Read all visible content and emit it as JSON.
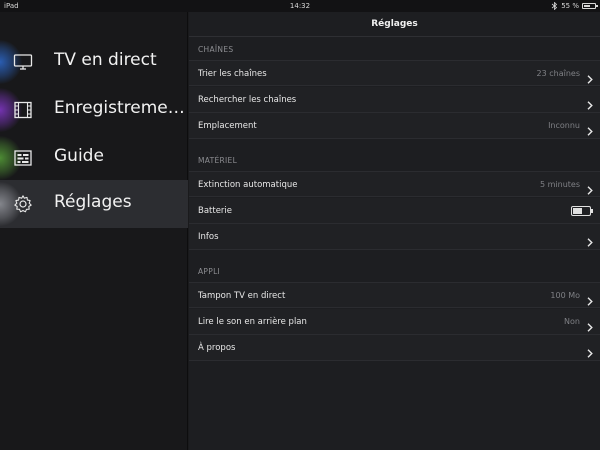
{
  "status_bar": {
    "device": "iPad",
    "time": "14:32",
    "battery_text": "55 %",
    "battery_level": 0.55
  },
  "sidebar": {
    "items": [
      {
        "label": "TV en direct",
        "icon": "tv-icon",
        "glow": "#2f6fd8",
        "active": false
      },
      {
        "label": "Enregistrements",
        "icon": "film-icon",
        "glow": "#8b3ad6",
        "active": false
      },
      {
        "label": "Guide",
        "icon": "guide-icon",
        "glow": "#5aa83a",
        "active": false
      },
      {
        "label": "Réglages",
        "icon": "gear-icon",
        "glow": "#9a9ca3",
        "active": true
      }
    ]
  },
  "main": {
    "title": "Réglages",
    "sections": [
      {
        "header": "CHAÎNES",
        "rows": [
          {
            "label": "Trier les chaînes",
            "value": "23 chaînes",
            "chevron": true
          },
          {
            "label": "Rechercher les chaînes",
            "value": "",
            "chevron": true
          },
          {
            "label": "Emplacement",
            "value": "Inconnu",
            "chevron": true
          }
        ]
      },
      {
        "header": "MATÉRIEL",
        "rows": [
          {
            "label": "Extinction automatique",
            "value": "5 minutes",
            "chevron": true
          },
          {
            "label": "Batterie",
            "value": "",
            "chevron": false,
            "battery_level": 0.55
          },
          {
            "label": "Infos",
            "value": "",
            "chevron": true
          }
        ]
      },
      {
        "header": "APPLI",
        "rows": [
          {
            "label": "Tampon TV en direct",
            "value": "100 Mo",
            "chevron": true
          },
          {
            "label": "Lire le son en arrière plan",
            "value": "Non",
            "chevron": true
          },
          {
            "label": "À propos",
            "value": "",
            "chevron": true
          }
        ]
      }
    ]
  }
}
